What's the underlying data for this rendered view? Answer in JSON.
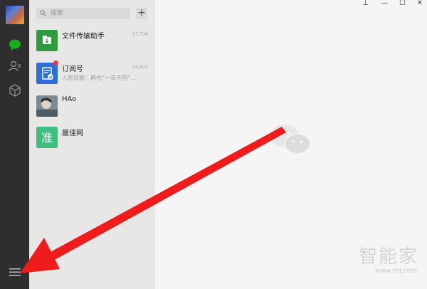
{
  "colors": {
    "sidebar_bg": "#2e2e2e",
    "list_bg": "#e8e7e6",
    "main_bg": "#f5f5f5",
    "accent_green": "#1aad19",
    "arrow_red": "#f01b1b"
  },
  "sidebar": {
    "icons": [
      "chat-bubble-icon",
      "contacts-icon",
      "favorites-cube-icon",
      "menu-icon"
    ]
  },
  "search": {
    "placeholder": "搜索"
  },
  "add_button": {
    "label": "+"
  },
  "chats": [
    {
      "name": "文件传输助手",
      "preview": "",
      "time": "17/7/4",
      "icon": "file-transfer-icon"
    },
    {
      "name": "订阅号",
      "preview": "人民日报：再也“一去不回”…",
      "time": "16/8/4",
      "icon": "subscription-icon",
      "badge": true
    },
    {
      "name": "HAo",
      "preview": "",
      "time": "",
      "icon": "avatar-photo"
    },
    {
      "name": "最佳网",
      "preview": "",
      "time": "",
      "icon": "green-logo-icon",
      "thumb_char": "准"
    }
  ],
  "window_controls": [
    "pin",
    "minimize",
    "maximize",
    "close"
  ],
  "watermark": {
    "brand": "智能家",
    "url": "www.znj.com"
  }
}
